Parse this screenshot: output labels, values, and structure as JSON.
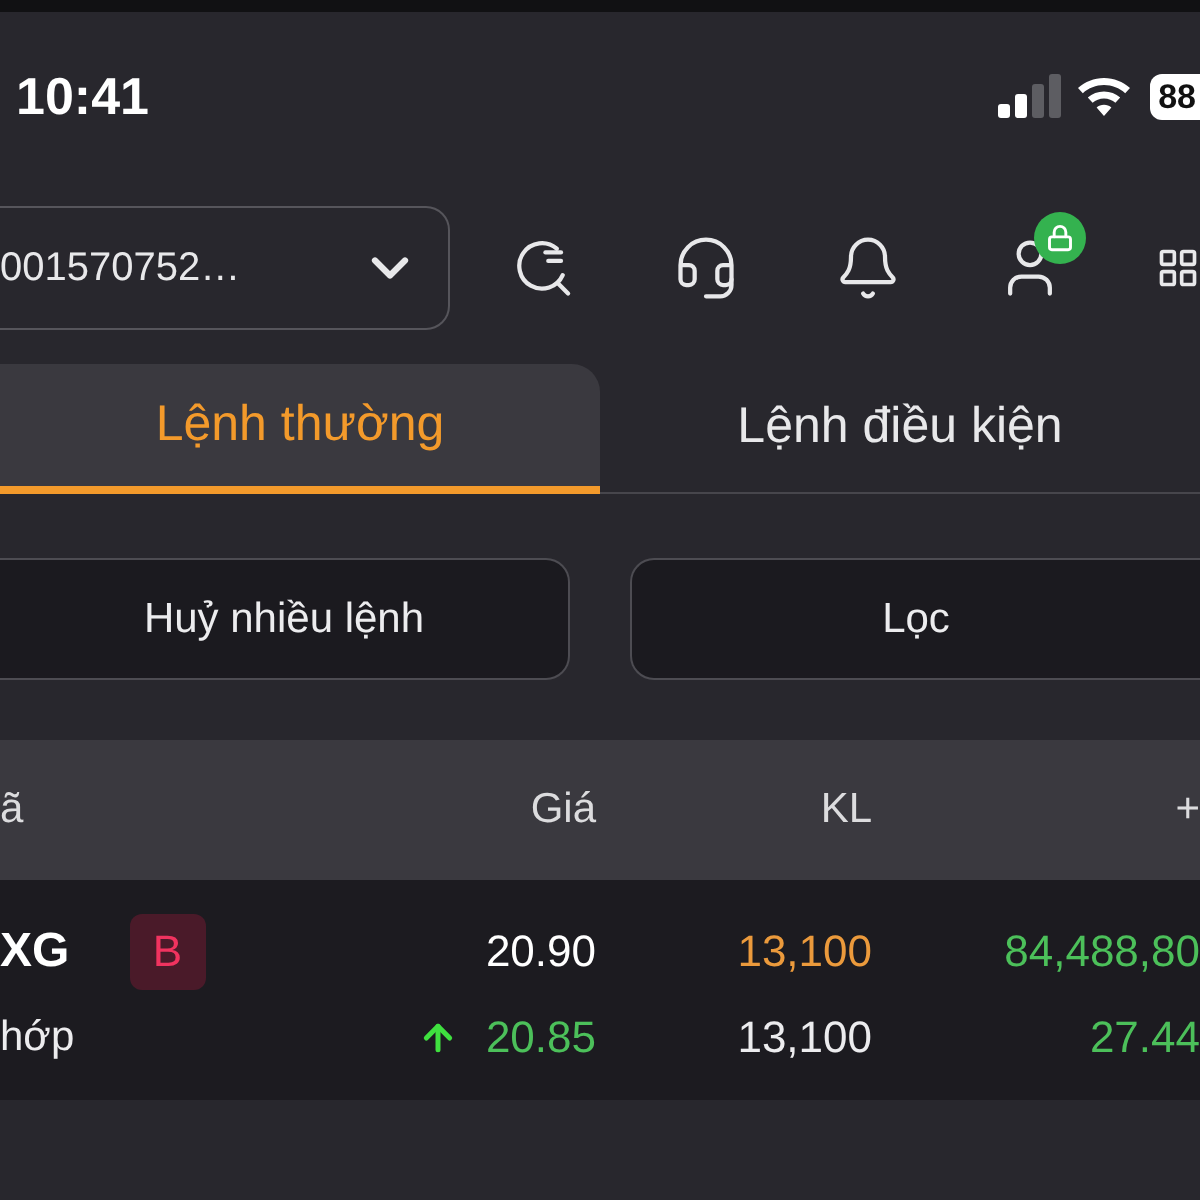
{
  "status_bar": {
    "time": "10:41",
    "battery": "88"
  },
  "toolbar": {
    "account": "001570752…"
  },
  "tabs": [
    {
      "label": "Lệnh thường",
      "selected": true
    },
    {
      "label": "Lệnh điều kiện",
      "selected": false
    }
  ],
  "actions": [
    "Huỷ nhiều lệnh",
    "Lọc"
  ],
  "table": {
    "columns": [
      "ã",
      "Giá",
      "KL",
      "+"
    ],
    "rows": [
      {
        "symbol": "XG",
        "side": "B",
        "price": "20.90",
        "volume": "13,100",
        "column_4": "84,488,80",
        "status": "hớp",
        "price_up": true,
        "matched_price": "20.85",
        "matched_volume": "13,100",
        "column_4_sub": "27.44"
      }
    ]
  }
}
